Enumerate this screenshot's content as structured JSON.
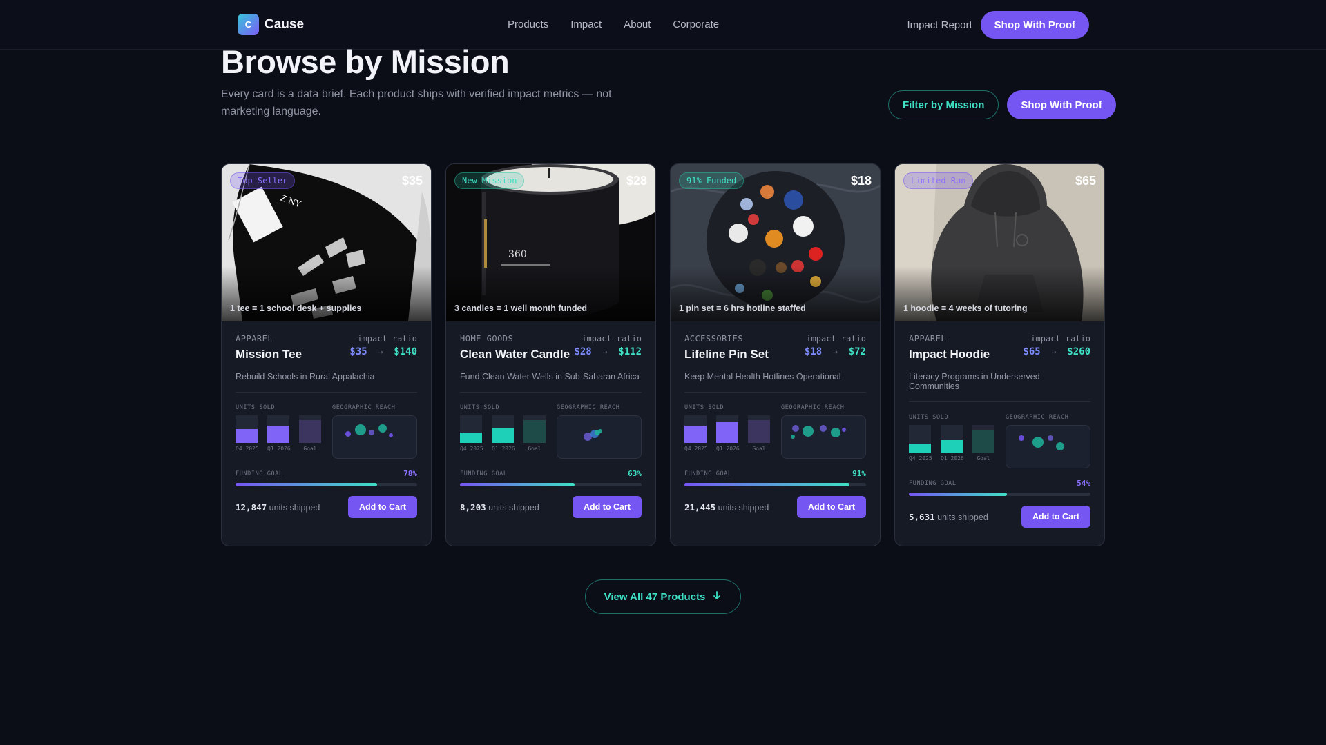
{
  "nav": {
    "logo_letter": "C",
    "brand": "Cause",
    "links": [
      "Products",
      "Impact",
      "About",
      "Corporate"
    ],
    "report": "Impact Report",
    "cta": "Shop With Proof"
  },
  "header": {
    "title": "Browse by Mission",
    "subtitle": "Every card is a data brief. Each product ships with verified impact metrics — not marketing language.",
    "filter_label": "Filter by Mission",
    "cta": "Shop With Proof"
  },
  "labels": {
    "impact_ratio": "impact ratio",
    "units_sold": "UNITS SOLD",
    "geographic_reach": "GEOGRAPHIC REACH",
    "funding_goal": "FUNDING GOAL",
    "units_shipped": "units shipped",
    "add_to_cart": "Add to Cart",
    "bar_q4": "Q4 2025",
    "bar_q1": "Q1 2026",
    "bar_goal": "Goal"
  },
  "colors": {
    "accent_purple": "#7656f3",
    "accent_teal": "#3fe0c5",
    "background": "#0b0e17"
  },
  "products": [
    {
      "badge": "Top Seller",
      "badge_style": "purple",
      "price": "$35",
      "caption": "1 tee = 1 school desk + supplies",
      "category": "APPAREL",
      "name": "Mission Tee",
      "ratio_from": "$35",
      "ratio_to": "$140",
      "mission": "Rebuild Schools in Rural Appalachia",
      "units_q4": 0.5,
      "units_q1": 0.62,
      "units_goal": 0.82,
      "bar_color": "purple",
      "funding_pct": "78%",
      "funding_value": 0.78,
      "pct_color": "purple",
      "shipped": "12,847"
    },
    {
      "badge": "New Mission",
      "badge_style": "teal",
      "price": "$28",
      "caption": "3 candles = 1 well month funded",
      "category": "HOME GOODS",
      "name": "Clean Water Candle",
      "ratio_from": "$28",
      "ratio_to": "$112",
      "mission": "Fund Clean Water Wells in Sub-Saharan Africa",
      "units_q4": 0.38,
      "units_q1": 0.52,
      "units_goal": 0.82,
      "bar_color": "teal",
      "funding_pct": "63%",
      "funding_value": 0.63,
      "pct_color": "teal",
      "shipped": "8,203"
    },
    {
      "badge": "91% Funded",
      "badge_style": "teal",
      "price": "$18",
      "caption": "1 pin set = 6 hrs hotline staffed",
      "category": "ACCESSORIES",
      "name": "Lifeline Pin Set",
      "ratio_from": "$18",
      "ratio_to": "$72",
      "mission": "Keep Mental Health Hotlines Operational",
      "units_q4": 0.62,
      "units_q1": 0.76,
      "units_goal": 0.82,
      "bar_color": "purple",
      "funding_pct": "91%",
      "funding_value": 0.91,
      "pct_color": "teal",
      "shipped": "21,445"
    },
    {
      "badge": "Limited Run",
      "badge_style": "purple",
      "price": "$65",
      "caption": "1 hoodie = 4 weeks of tutoring",
      "category": "APPAREL",
      "name": "Impact Hoodie",
      "ratio_from": "$65",
      "ratio_to": "$260",
      "mission": "Literacy Programs in Underserved Communities",
      "units_q4": 0.32,
      "units_q1": 0.44,
      "units_goal": 0.82,
      "bar_color": "teal",
      "funding_pct": "54%",
      "funding_value": 0.54,
      "pct_color": "purple",
      "shipped": "5,631"
    }
  ],
  "view_all": "View All 47 Products"
}
